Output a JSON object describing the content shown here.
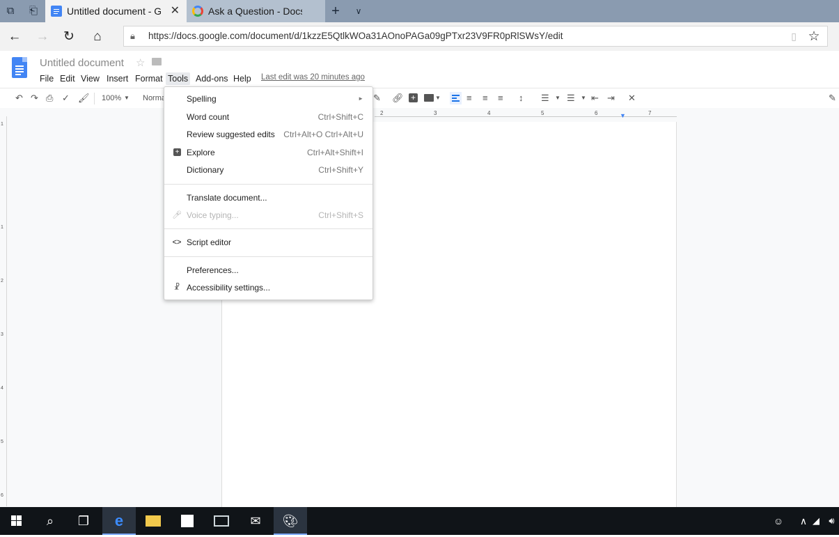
{
  "browser": {
    "tabs": [
      {
        "label": "Untitled document - Go",
        "active": true
      },
      {
        "label": "Ask a Question - Docs Edito",
        "active": false
      }
    ],
    "url": "https://docs.google.com/document/d/1kzzE5QtlkWOa31AOnoPAGa09gPTxr23V9FR0pRlSWsY/edit"
  },
  "doc": {
    "title": "Untitled document",
    "menus": [
      "File",
      "Edit",
      "View",
      "Insert",
      "Format",
      "Tools",
      "Add-ons",
      "Help"
    ],
    "last_edit": "Last edit was 20 minutes ago"
  },
  "toolbar": {
    "zoom": "100%",
    "style": "Normal"
  },
  "ruler": {
    "h_numbers": [
      "2",
      "3",
      "4",
      "5",
      "6",
      "7"
    ],
    "v_numbers": [
      "1",
      "1",
      "2",
      "3",
      "4",
      "5",
      "6"
    ]
  },
  "tools_menu": {
    "items": [
      {
        "label": "Spelling",
        "shortcut": "►",
        "icon": "",
        "disabled": false
      },
      {
        "label": "Word count",
        "shortcut": "Ctrl+Shift+C",
        "icon": "",
        "disabled": false
      },
      {
        "label": "Review suggested edits",
        "shortcut": "Ctrl+Alt+O Ctrl+Alt+U",
        "icon": "",
        "disabled": false
      },
      {
        "label": "Explore",
        "shortcut": "Ctrl+Alt+Shift+I",
        "icon": "explore-icon",
        "disabled": false
      },
      {
        "label": "Dictionary",
        "shortcut": "Ctrl+Shift+Y",
        "icon": "",
        "disabled": false
      },
      {
        "label": "Translate document...",
        "shortcut": "",
        "icon": "",
        "disabled": false
      },
      {
        "label": "Voice typing...",
        "shortcut": "Ctrl+Shift+S",
        "icon": "microphone-icon",
        "disabled": true
      },
      {
        "label": "Script editor",
        "shortcut": "",
        "icon": "code-icon",
        "disabled": false
      },
      {
        "label": "Preferences...",
        "shortcut": "",
        "icon": "",
        "disabled": false
      },
      {
        "label": "Accessibility settings...",
        "shortcut": "",
        "icon": "accessibility-icon",
        "disabled": false
      }
    ]
  },
  "colors": {
    "docs_blue": "#4285f4",
    "tabbar": "#8a9bb0",
    "taskbar": "#101418",
    "active_align": "#1a73e8"
  }
}
